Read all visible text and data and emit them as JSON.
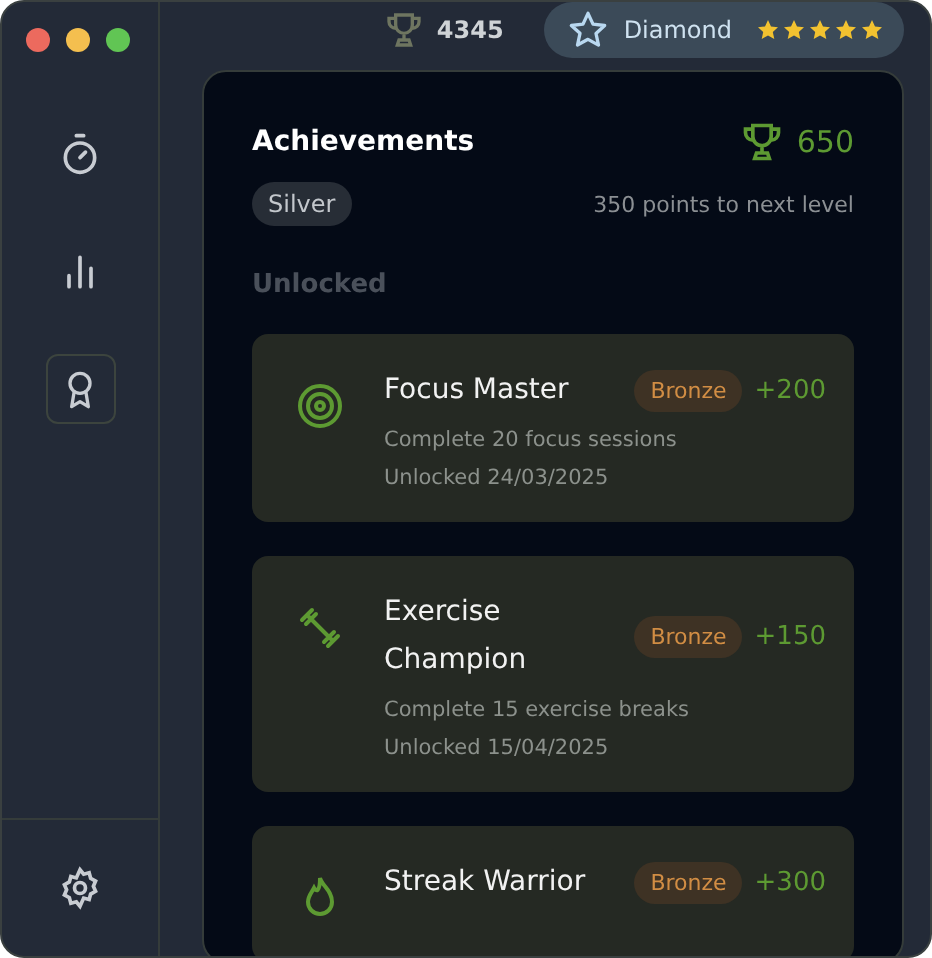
{
  "sidebar": {
    "items": [
      {
        "kind": "timer",
        "selected": false
      },
      {
        "kind": "stats",
        "selected": false
      },
      {
        "kind": "award",
        "selected": true
      }
    ]
  },
  "header": {
    "points": "4345",
    "rank": {
      "label": "Diamond",
      "stars": 5
    }
  },
  "panel": {
    "title": "Achievements",
    "total": "650",
    "level_badge": "Silver",
    "progress_note": "350 points to next level",
    "section": "Unlocked",
    "achievements": [
      {
        "kind": "target",
        "title": "Focus Master",
        "tier": "Bronze",
        "points": "+200",
        "description": "Complete 20 focus sessions",
        "date": "Unlocked 24/03/2025"
      },
      {
        "kind": "dumbbell",
        "title": "Exercise Champion",
        "tier": "Bronze",
        "points": "+150",
        "description": "Complete 15 exercise breaks",
        "date": "Unlocked 15/04/2025"
      },
      {
        "kind": "flame",
        "title": "Streak Warrior",
        "tier": "Bronze",
        "points": "+300"
      }
    ]
  }
}
